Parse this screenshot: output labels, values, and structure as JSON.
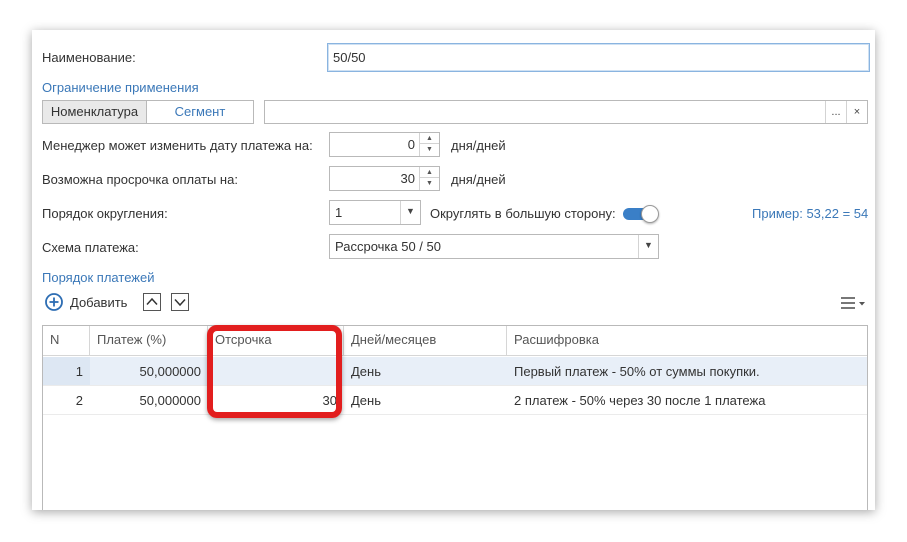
{
  "form": {
    "name_label": "Наименование:",
    "name_value": "50/50",
    "restriction_link": "Ограничение применения",
    "restriction_tabs": [
      "Номенклатура",
      "Сегмент"
    ],
    "restriction_select_btn": "...",
    "restriction_clear_btn": "×",
    "manager_label": "Менеджер может изменить дату платежа на:",
    "manager_value": "0",
    "manager_unit": "дня/дней",
    "overdue_label": "Возможна просрочка оплаты на:",
    "overdue_value": "30",
    "overdue_unit": "дня/дней",
    "rounding_label": "Порядок округления:",
    "rounding_value": "1",
    "round_up_label": "Округлять в большую сторону:",
    "round_up_on": true,
    "example_text": "Пример: 53,22 = 54",
    "scheme_label": "Схема платежа:",
    "scheme_value": "Рассрочка 50 / 50"
  },
  "payments": {
    "title": "Порядок платежей",
    "add_label": "Добавить",
    "columns": [
      "N",
      "Платеж (%)",
      "Отсрочка",
      "Дней/месяцев",
      "Расшифровка"
    ],
    "rows": [
      {
        "n": "1",
        "percent": "50,000000",
        "delay": "",
        "unit": "День",
        "desc": "Первый платеж - 50% от суммы покупки."
      },
      {
        "n": "2",
        "percent": "50,000000",
        "delay": "30",
        "unit": "День",
        "desc": "2 платеж - 50% через 30  после 1 платежа"
      }
    ]
  },
  "colors": {
    "accent": "#3a7fc7",
    "link": "#3b78b8",
    "highlight_frame": "#e21e1e",
    "selected_row": "#e8eff8"
  },
  "icons": {
    "add": "plus-circle-icon",
    "move_up": "chevron-up-icon",
    "move_down": "chevron-down-icon",
    "more": "menu-lines-icon"
  }
}
